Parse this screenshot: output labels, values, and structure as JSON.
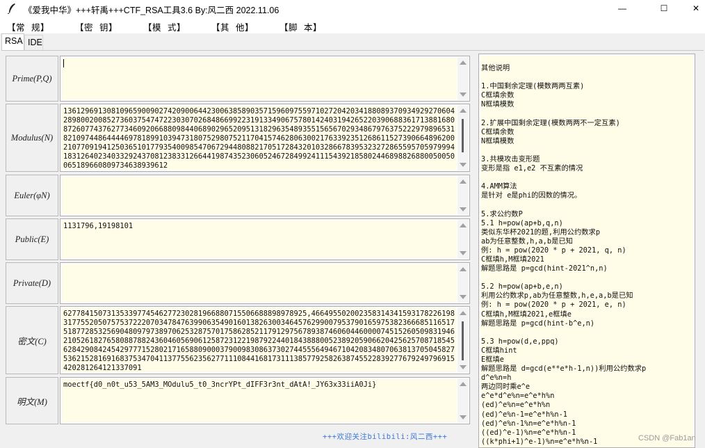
{
  "window": {
    "title": "《爱我中华》+++轩禹+++CTF_RSA工具3.6  By:风二西 2022.11.06",
    "controls": {
      "minimize": "—",
      "maximize": "☐",
      "close": "✕"
    }
  },
  "menu": {
    "items": [
      {
        "label": "【常  规】"
      },
      {
        "label": "【密  钥】"
      },
      {
        "label": "【模  式】"
      },
      {
        "label": "【其  他】"
      },
      {
        "label": "【脚  本】"
      }
    ]
  },
  "tabs": [
    {
      "label": "RSA",
      "active": true
    },
    {
      "label": "IDE",
      "active": false
    }
  ],
  "fields": {
    "prime": {
      "label": "Prime(P,Q)",
      "value": ""
    },
    "modulus": {
      "label": "Modulus(N)",
      "value": "136129691308109659009027420900644230063858903571596097559710272042034188089370934929270604289800200852736037547472230307026848669922319133490675780142403194265220390688361713881680872607743762773460920668809844068902965209513182963548935515656702934867976375222979896531821097448644446978189910394731807529807521170415746280630021763392351268611527390664896200210770919412503651017793540098547067294480882170517284320103286678395323272865595705979994183126402340332924370812383312664419874352306052467284992411154392185802446898826880050050065189660809734638939612"
    },
    "euler": {
      "label": "Euler(φN)",
      "value": ""
    },
    "public": {
      "label": "Public(E)",
      "value": "1131796,19198101"
    },
    "private": {
      "label": "Private(D)",
      "value": ""
    },
    "cipher": {
      "label": "密文(C)",
      "value": "62778415073135339774546277230281966880715506688898978925,466495502002358314341593178226198317755205075753722207034784763990635490160138263003464576299007953790165975382366685116517518772853256904809797389706253287570175862852117912975678938746060446000074515260509831946210526182765808878824360460569061258723122198792244018438880052389205906620425625708718545628429084245429777152802171658809000379009830863730274455564946710420834807063813705045827536215281691683753470411377556235627711108441681731113857792582638745522839277679249796915420281264121337091"
    },
    "plain": {
      "label": "明文(M)",
      "value": "moectf{d0_n0t_u53_5AM3_MOdulu5_t0_3ncrYPt_dIFF3r3nt_dAtA!_JY63x33iiA0Ji}"
    }
  },
  "footer": {
    "link": "+++欢迎关注bilibili:风二西+++"
  },
  "side_notes": "其他说明\n\n1.中国剩余定理(模数两两互素)\nC框填余数\nN框填模数\n\n2.扩展中国剩余定理(模数两两不一定互素)\nC框填余数\nN框填模数\n\n3.共模攻击变形题\n变形是指 e1,e2 不互素的情况\n\n4.AMM算法\n是针对 e是phi的因数的情况。\n\n5.求公约数P\n5.1 h=pow(ap+b,q,n)\n类似东华杯2021的题,利用公约数求p\nab为任意整数,h,a,b是已知\n例: h = pow(2020 * p + 2021, q, n)\nC框填h,M框填2021\n解题思路是 p=gcd(hint-2021^n,n)\n\n5.2 h=pow(ap+b,e,n)\n利用公约数求p,ab为任意整数,h,e,a,b是已知\n例: h = pow(2020 * p + 2021, e, n)\nC框填h,M框填2021,e框填e\n解题思路是 p=gcd(hint-b^e,n)\n\n5.3 h=pow(d,e,ppq)\nC框填hint\nE框填e\n解题思路是 d=gcd(e**e*h-1,n))利用公约数求p\nd^e%n=h\n两边同时乘e^e\ne^e*d^e%n=e^e*h%n\n(ed)^e%n=e^e*h%n\n(ed)^e%n-1=e^e*h%n-1\n(ed)^e%n-1%n=e^e*h%n-1\n((ed)^e-1)%n=e^e*h%n-1\n((k*phi+1)^e-1)%n=e^e*h%n-1",
  "watermark": "CSDN @Fab1an"
}
